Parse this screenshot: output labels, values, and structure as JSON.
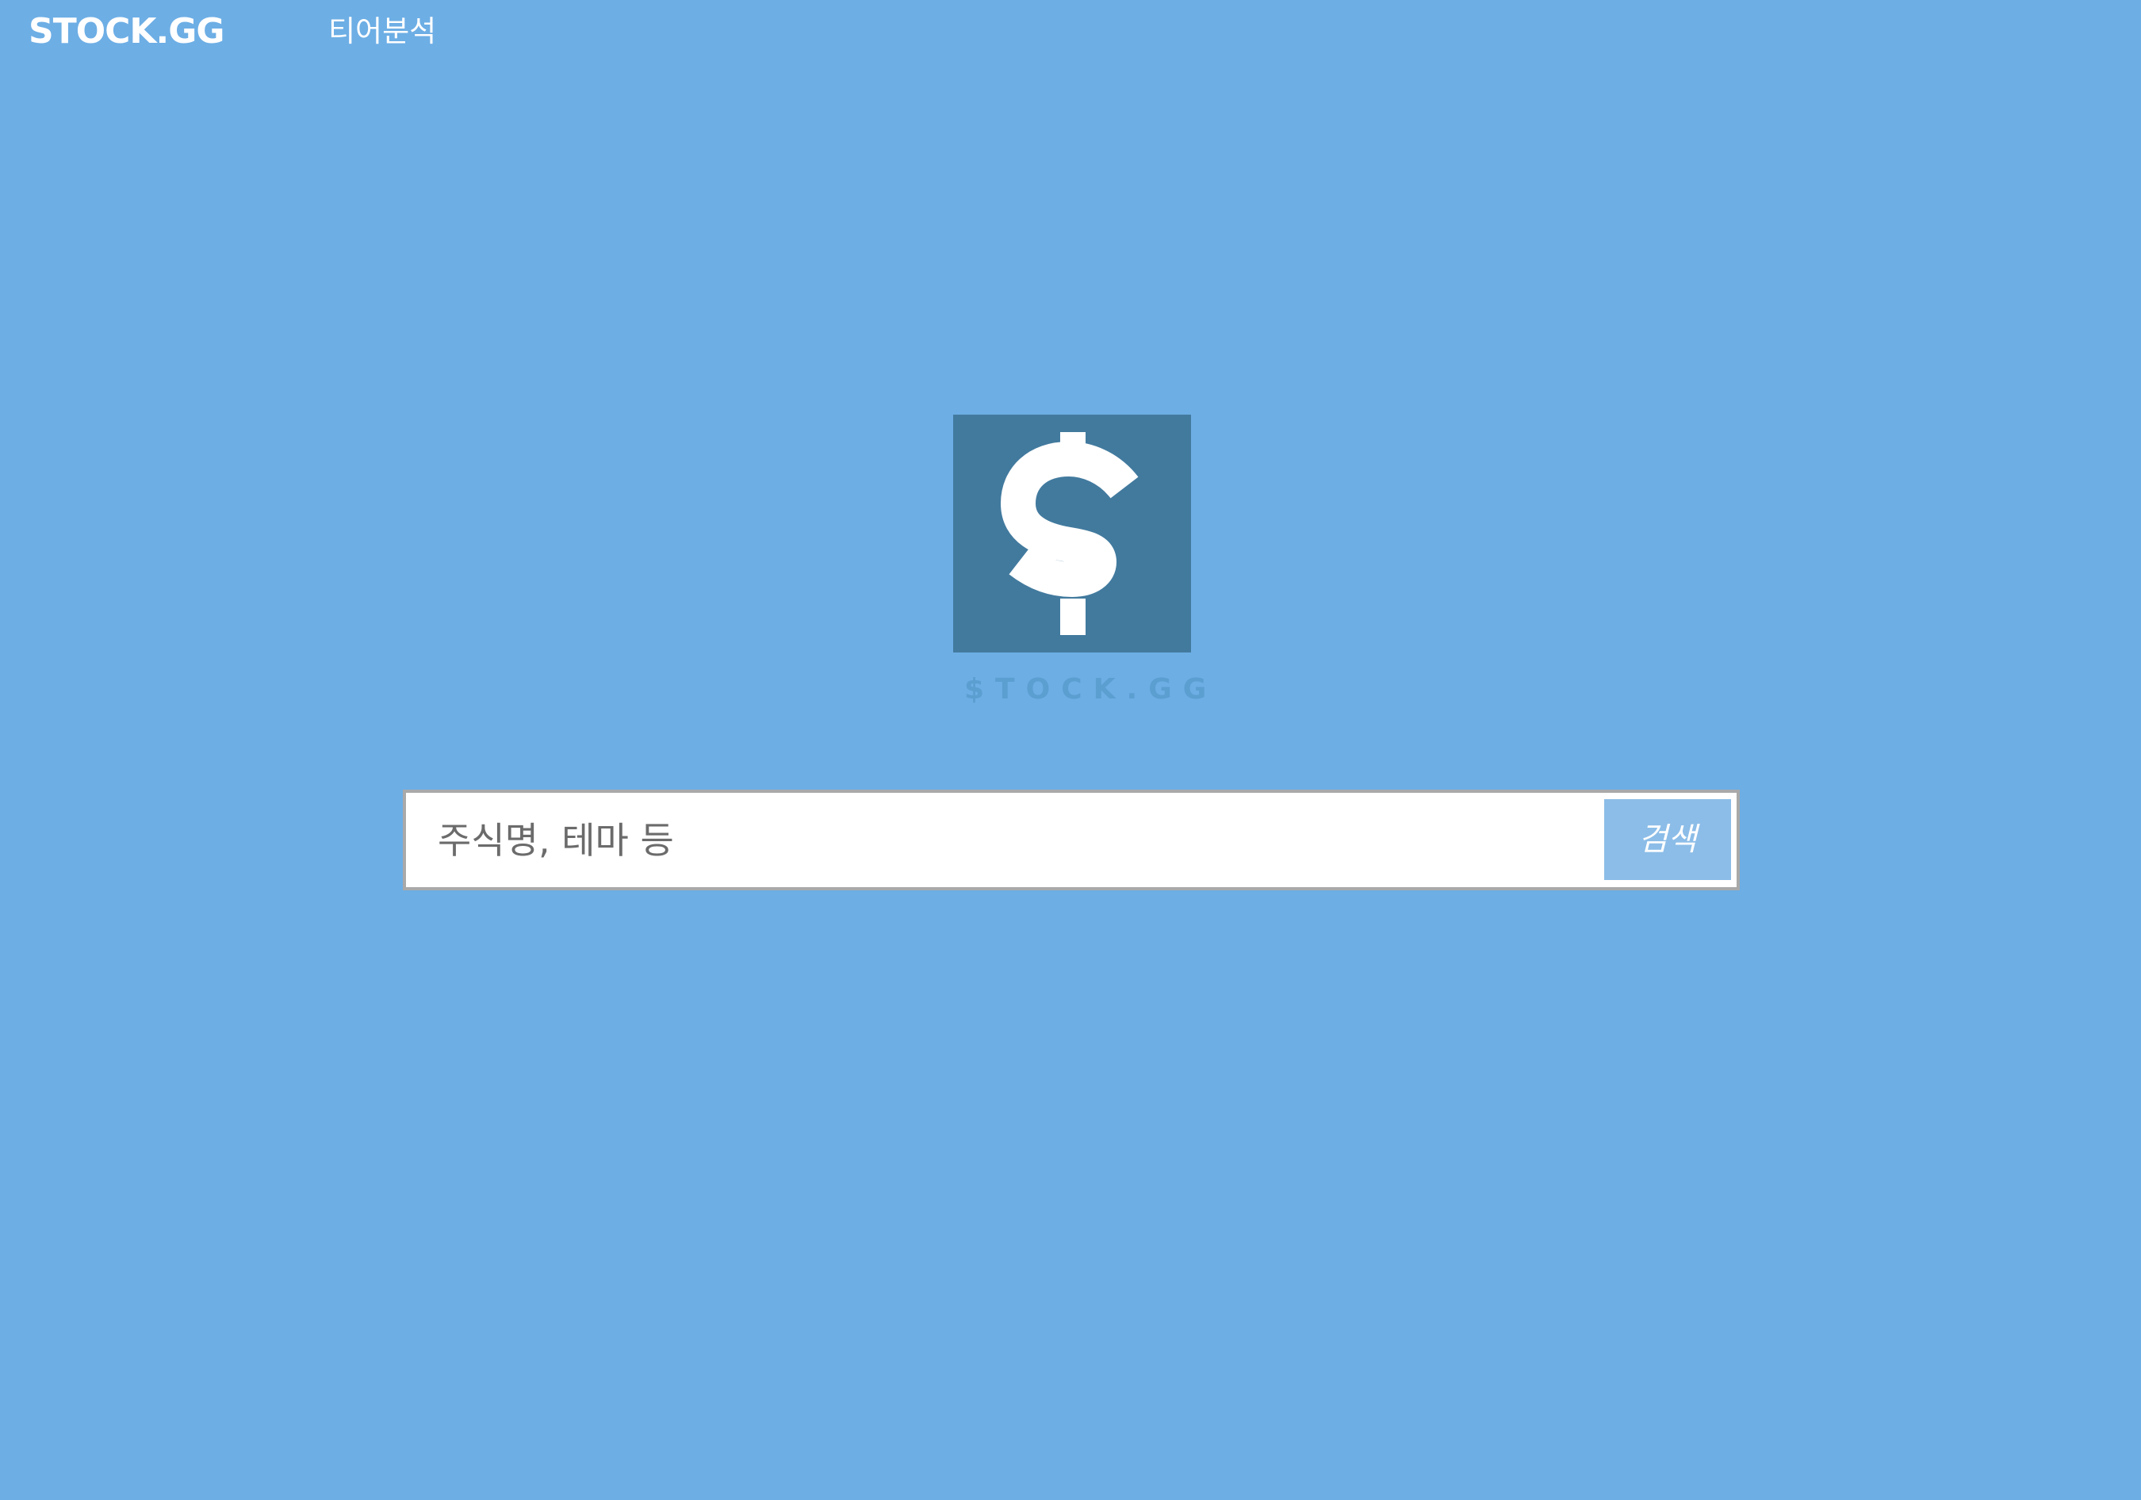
{
  "colors": {
    "background": "#6daee5",
    "logo_box": "#427a9e",
    "logo_dollar": "#ffffff",
    "logo_text": "#5b9ed0",
    "search_button": "#8cbde8",
    "search_border": "#a9a9a9"
  },
  "header": {
    "brand": "STOCK.GG",
    "nav": [
      {
        "label": "티어분석"
      }
    ]
  },
  "hero": {
    "logo_icon": "dollar-sign-icon",
    "logo_text": "$TOCK.GG"
  },
  "search": {
    "placeholder": "주식명, 테마 등",
    "value": "",
    "button_label": "검색"
  }
}
